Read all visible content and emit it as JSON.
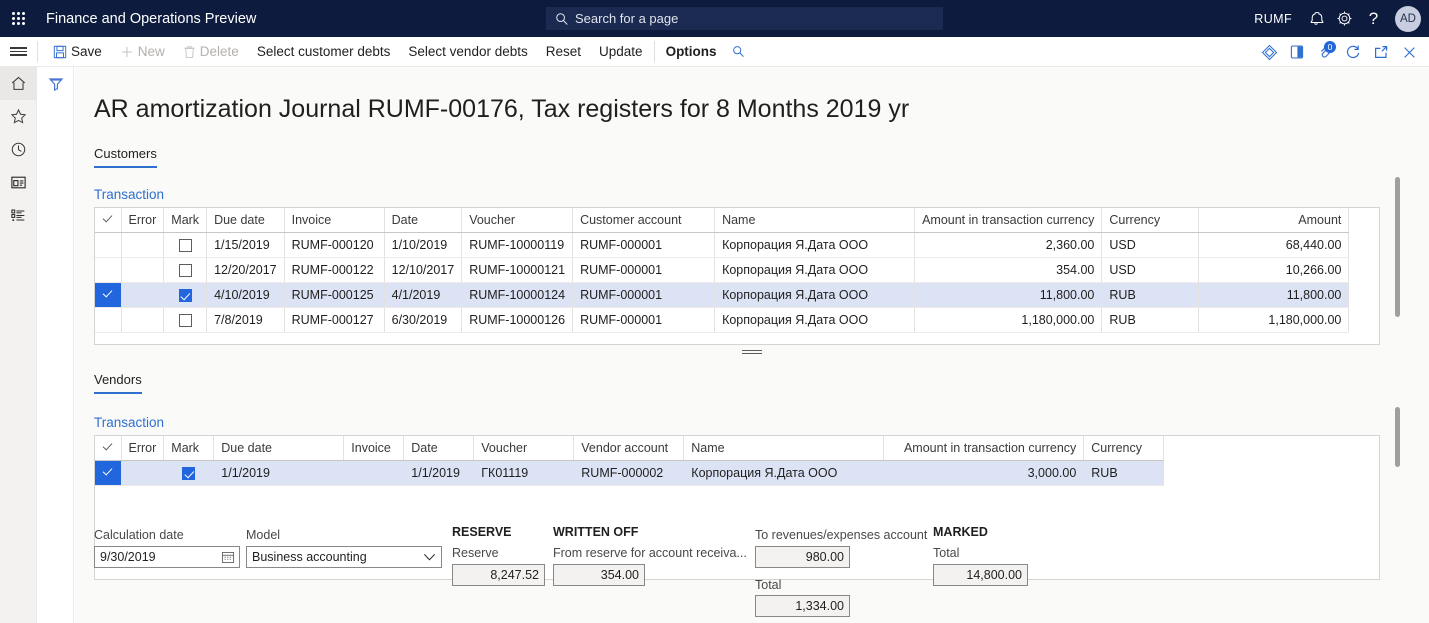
{
  "topbar": {
    "waffle_label": "app-launcher",
    "app_title": "Finance and Operations Preview",
    "search_placeholder": "Search for a page",
    "company": "RUMF",
    "notification_icon": "bell-icon",
    "settings_icon": "gear-icon",
    "help_icon": "question-icon",
    "avatar_initials": "AD"
  },
  "commandbar": {
    "save_label": "Save",
    "new_label": "New",
    "delete_label": "Delete",
    "select_customer_debts_label": "Select customer debts",
    "select_vendor_debts_label": "Select vendor debts",
    "reset_label": "Reset",
    "update_label": "Update",
    "options_label": "Options",
    "search_icon": "search-icon",
    "right_icons": [
      {
        "name": "office-diamond-icon"
      },
      {
        "name": "split-view-icon"
      },
      {
        "name": "attachments-icon",
        "badge": "0"
      },
      {
        "name": "refresh-icon"
      },
      {
        "name": "open-in-new-window-icon"
      },
      {
        "name": "close-icon"
      }
    ]
  },
  "rail": {
    "items": [
      {
        "name": "home-icon"
      },
      {
        "name": "favorites-star-icon"
      },
      {
        "name": "recent-clock-icon"
      },
      {
        "name": "workspaces-icon"
      },
      {
        "name": "modules-list-icon"
      }
    ],
    "filter_icon": "filter-icon"
  },
  "page": {
    "title": "AR amortization Journal RUMF-00176, Tax registers for 8 Months 2019 yr"
  },
  "customers_section": {
    "tab_label": "Customers",
    "transaction_link": "Transaction",
    "columns": [
      "Error",
      "Mark",
      "Due date",
      "Invoice",
      "Date",
      "Voucher",
      "Customer account",
      "Name",
      "Amount in transaction currency",
      "Currency",
      "Amount"
    ],
    "rows": [
      {
        "selected": false,
        "marked": false,
        "error": "",
        "due_date": "1/15/2019",
        "invoice": "RUMF-000120",
        "date": "1/10/2019",
        "voucher": "RUMF-10000119",
        "account": "RUMF-000001",
        "name": "Корпорация Я.Дата ООО",
        "amount_transaction": "2,360.00",
        "currency": "USD",
        "amount": "68,440.00"
      },
      {
        "selected": false,
        "marked": false,
        "error": "",
        "due_date": "12/20/2017",
        "invoice": "RUMF-000122",
        "date": "12/10/2017",
        "voucher": "RUMF-10000121",
        "account": "RUMF-000001",
        "name": "Корпорация Я.Дата ООО",
        "amount_transaction": "354.00",
        "currency": "USD",
        "amount": "10,266.00"
      },
      {
        "selected": true,
        "marked": true,
        "error": "",
        "due_date": "4/10/2019",
        "invoice": "RUMF-000125",
        "date": "4/1/2019",
        "voucher": "RUMF-10000124",
        "account": "RUMF-000001",
        "name": "Корпорация Я.Дата ООО",
        "amount_transaction": "11,800.00",
        "currency": "RUB",
        "amount": "11,800.00"
      },
      {
        "selected": false,
        "marked": false,
        "error": "",
        "due_date": "7/8/2019",
        "invoice": "RUMF-000127",
        "date": "6/30/2019",
        "voucher": "RUMF-10000126",
        "account": "RUMF-000001",
        "name": "Корпорация Я.Дата ООО",
        "amount_transaction": "1,180,000.00",
        "currency": "RUB",
        "amount": "1,180,000.00"
      }
    ]
  },
  "vendors_section": {
    "tab_label": "Vendors",
    "transaction_link": "Transaction",
    "columns": [
      "Error",
      "Mark",
      "Due date",
      "Invoice",
      "Date",
      "Voucher",
      "Vendor account",
      "Name",
      "Amount in transaction currency",
      "Currency"
    ],
    "rows": [
      {
        "selected": true,
        "marked": true,
        "error": "",
        "due_date": "1/1/2019",
        "invoice": "",
        "date": "1/1/2019",
        "voucher": "ГК01119",
        "account": "RUMF-000002",
        "name": "Корпорация Я.Дата ООО",
        "amount_transaction": "3,000.00",
        "currency": "RUB"
      }
    ]
  },
  "footer_form": {
    "calculation_date_label": "Calculation date",
    "calculation_date_value": "9/30/2019",
    "calendar_icon": "calendar-icon",
    "model_label": "Model",
    "model_value": "Business accounting",
    "model_chevron_icon": "chevron-down-icon",
    "reserve_group_label": "RESERVE",
    "reserve_label": "Reserve",
    "reserve_value": "8,247.52",
    "written_off_group_label": "WRITTEN OFF",
    "from_reserve_label": "From reserve for account receiva...",
    "from_reserve_value": "354.00",
    "to_revenues_label": "To revenues/expenses account",
    "to_revenues_value": "980.00",
    "written_off_total_label": "Total",
    "written_off_total_value": "1,334.00",
    "marked_group_label": "MARKED",
    "marked_total_label": "Total",
    "marked_total_value": "14,800.00"
  },
  "colors": {
    "nav_background": "#0d1b3e",
    "accent": "#2f6fd0",
    "selection_row": "#dbe3f5",
    "selection_cell": "#2266dd",
    "canvas": "#fafaf9"
  }
}
